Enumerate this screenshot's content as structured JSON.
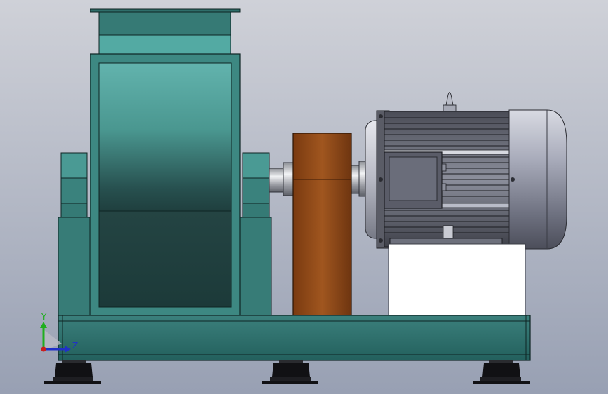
{
  "triad": {
    "y_label": "Y",
    "z_label": "Z",
    "colors": {
      "y": "#1fae1f",
      "z": "#2030c8",
      "x": "#c81e1e"
    }
  },
  "colors": {
    "background_top": "#c9ccd4",
    "background_bottom": "#9aa2b4",
    "fan_teal": "#3d8a85",
    "fan_dark": "#1f3e3d",
    "coupling_brown": "#8b4416",
    "motor_gray": "#7a7d8c",
    "motor_dark": "#3b3d47",
    "base_teal": "#2c6c69",
    "feet_black": "#101014"
  }
}
